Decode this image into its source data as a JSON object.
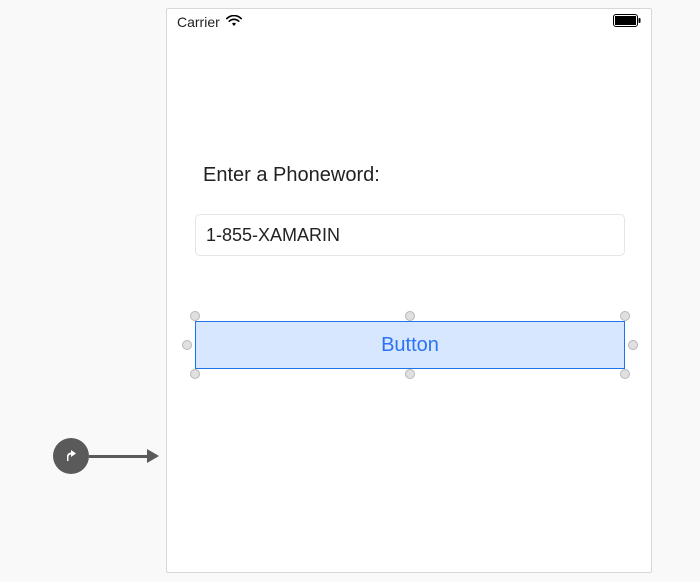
{
  "status_bar": {
    "carrier_label": "Carrier",
    "wifi_icon": "wifi",
    "battery_icon": "battery"
  },
  "form": {
    "label": "Enter a Phoneword:",
    "phoneword_value": "1-855-XAMARIN",
    "button_label": "Button"
  },
  "designer": {
    "selection_handles": 8
  }
}
